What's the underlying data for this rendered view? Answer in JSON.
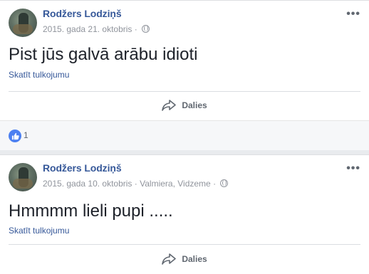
{
  "posts": [
    {
      "author": "Rodžers Lodziņš",
      "timestamp": "2015. gada 21. oktobris",
      "location": "",
      "body": "Pist jūs galvā arābu idioti",
      "translate_label": "Skatīt tulkojumu",
      "share_label": "Dalies",
      "like_count": "1",
      "more_icon": "more-options-icon",
      "privacy_icon": "globe-icon"
    },
    {
      "author": "Rodžers Lodziņš",
      "timestamp": "2015. gada 10. oktobris",
      "location": "Valmiera, Vidzeme",
      "body": "Hmmmm lieli pupi .....",
      "translate_label": "Skatīt tulkojumu",
      "share_label": "Dalies",
      "more_icon": "more-options-icon",
      "privacy_icon": "globe-icon"
    }
  ],
  "colors": {
    "link": "#365899",
    "meta": "#90949c",
    "text": "#1d2129",
    "like_blue": "#4c80f1",
    "feed_bg": "#e9ebee"
  }
}
